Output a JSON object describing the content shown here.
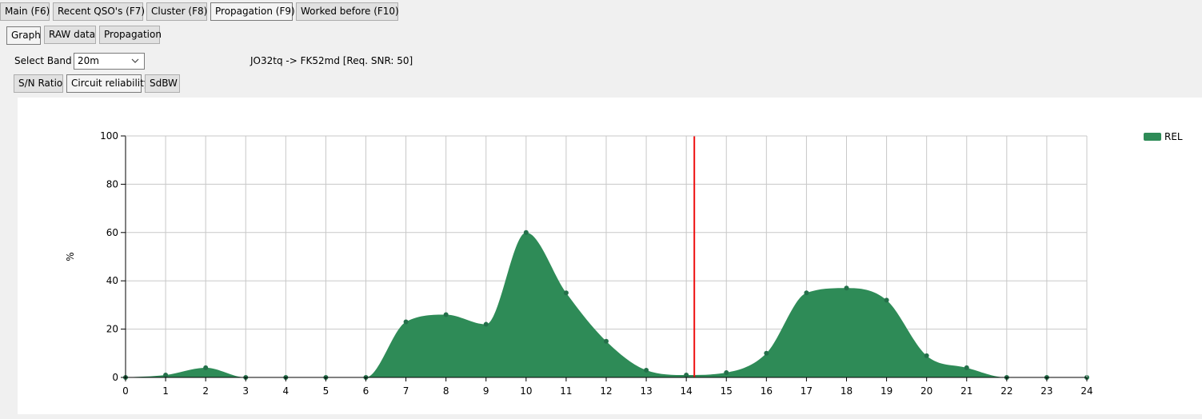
{
  "main_tabs": [
    {
      "label": "Main (F6)",
      "active": false
    },
    {
      "label": "Recent QSO's (F7)",
      "active": false
    },
    {
      "label": "Cluster (F8)",
      "active": false
    },
    {
      "label": "Propagation (F9)",
      "active": true
    },
    {
      "label": "Worked before (F10)",
      "active": false
    }
  ],
  "sub_tabs": [
    {
      "label": "Graph",
      "active": true
    },
    {
      "label": "RAW data",
      "active": false
    },
    {
      "label": "Propagation",
      "active": false
    }
  ],
  "band": {
    "label": "Select Band",
    "selected": "20m"
  },
  "path_info": "JO32tq -> FK52md [Req. SNR: 50]",
  "metric_buttons": [
    {
      "label": "S/N Ratio",
      "active": false
    },
    {
      "label": "Circuit reliability",
      "active": true
    },
    {
      "label": "SdBW",
      "active": false
    }
  ],
  "colors": {
    "series": "#2e8b57",
    "marker": "#ee1111",
    "grid": "#c8c8c8"
  },
  "chart_data": {
    "type": "area",
    "x": [
      0,
      1,
      2,
      3,
      4,
      5,
      6,
      7,
      8,
      9,
      10,
      11,
      12,
      13,
      14,
      15,
      16,
      17,
      18,
      19,
      20,
      21,
      22,
      23,
      24
    ],
    "series": [
      {
        "name": "REL",
        "values": [
          0,
          1,
          4,
          0,
          0,
          0,
          0,
          23,
          26,
          22,
          60,
          35,
          15,
          3,
          1,
          2,
          10,
          35,
          37,
          32,
          9,
          4,
          0,
          0,
          0
        ]
      }
    ],
    "ylabel": "%",
    "xlim": [
      0,
      24
    ],
    "ylim": [
      0,
      100
    ],
    "x_ticks": [
      "0",
      "1",
      "2",
      "3",
      "4",
      "5",
      "6",
      "7",
      "8",
      "9",
      "10",
      "11",
      "12",
      "13",
      "14",
      "15",
      "16",
      "17",
      "18",
      "19",
      "20",
      "21",
      "22",
      "23",
      "24"
    ],
    "y_ticks": [
      "0",
      "20",
      "40",
      "60",
      "80",
      "100"
    ],
    "marker_x": 14.2,
    "grid": true,
    "legend_position": "top-right"
  }
}
